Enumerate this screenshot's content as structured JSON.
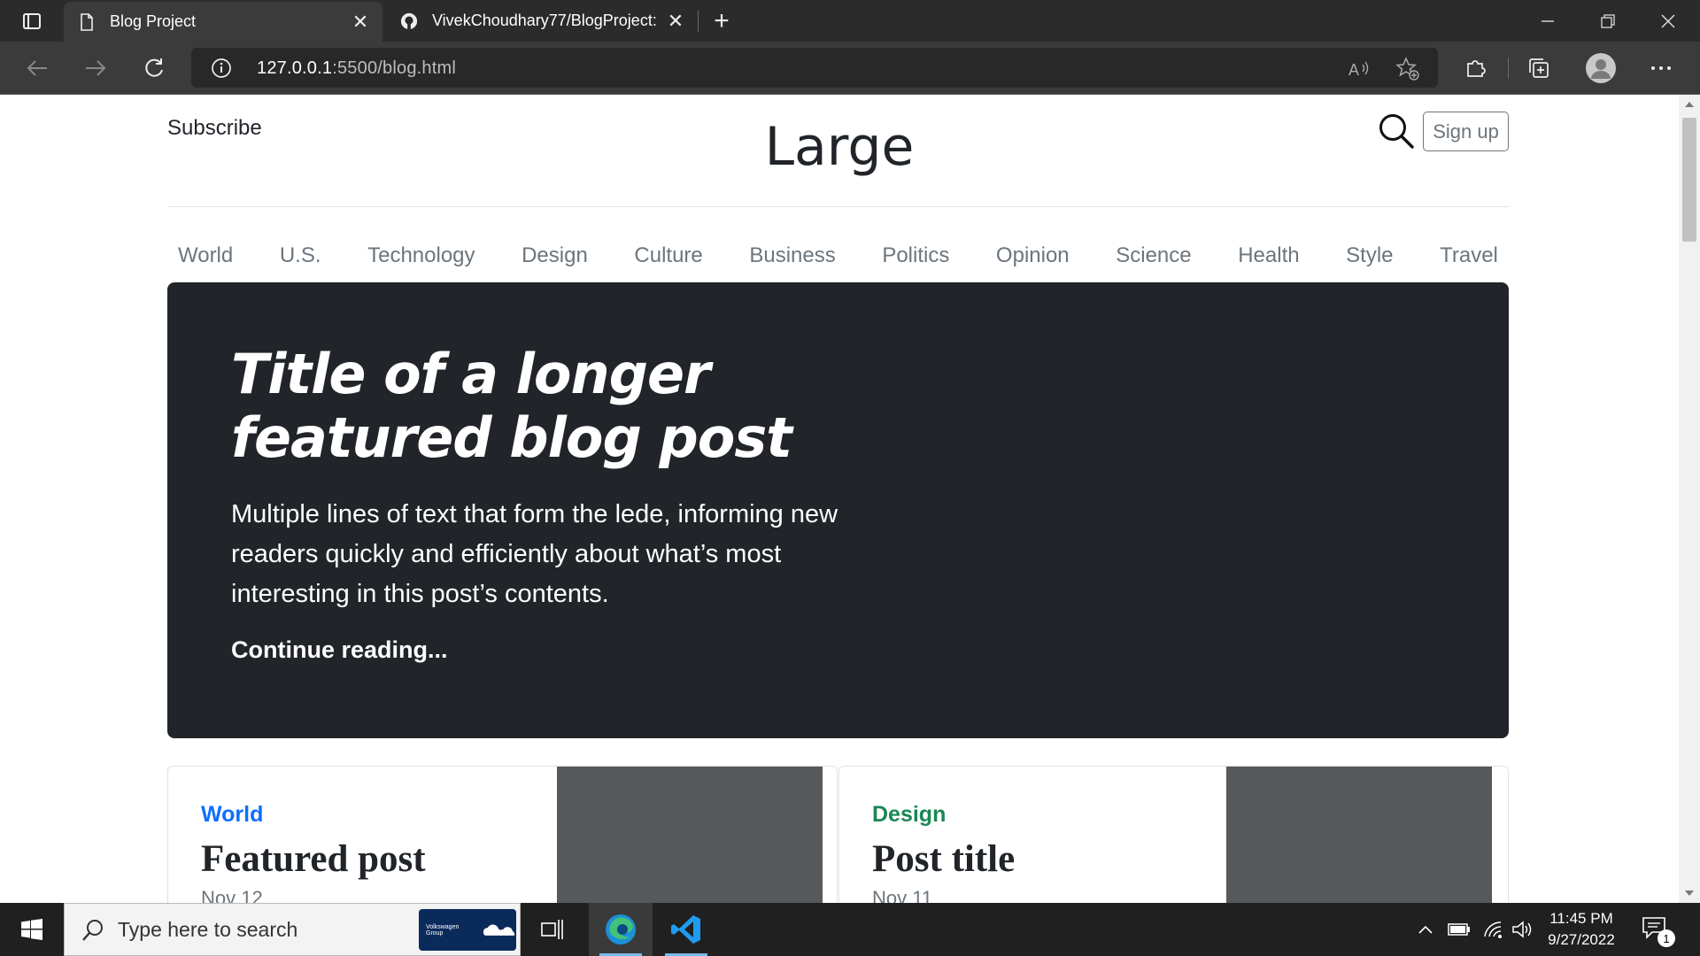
{
  "browser": {
    "tabs": [
      {
        "title": "Blog Project",
        "favicon": "document-icon",
        "active": true
      },
      {
        "title": "VivekChoudhary77/BlogProject: ",
        "favicon": "github-icon",
        "active": false
      }
    ],
    "url_host": "127.0.0.1",
    "url_rest": ":5500/blog.html"
  },
  "page": {
    "subscribe": "Subscribe",
    "brand": "Large",
    "signup": "Sign up",
    "categories": [
      "World",
      "U.S.",
      "Technology",
      "Design",
      "Culture",
      "Business",
      "Politics",
      "Opinion",
      "Science",
      "Health",
      "Style",
      "Travel"
    ],
    "hero": {
      "title": "Title of a longer featured blog post",
      "lede": "Multiple lines of text that form the lede, informing new readers quickly and efficiently about what’s most interesting in this post’s contents.",
      "link": "Continue reading..."
    },
    "cards": [
      {
        "category": "World",
        "category_color": "#0d6efd",
        "title": "Featured post",
        "date": "Nov 12"
      },
      {
        "category": "Design",
        "category_color": "#198754",
        "title": "Post title",
        "date": "Nov 11"
      }
    ]
  },
  "taskbar": {
    "search_placeholder": "Type here to search",
    "promo_text": "Volkswagen Group",
    "time": "11:45 PM",
    "date": "9/27/2022",
    "notifications": "1"
  }
}
